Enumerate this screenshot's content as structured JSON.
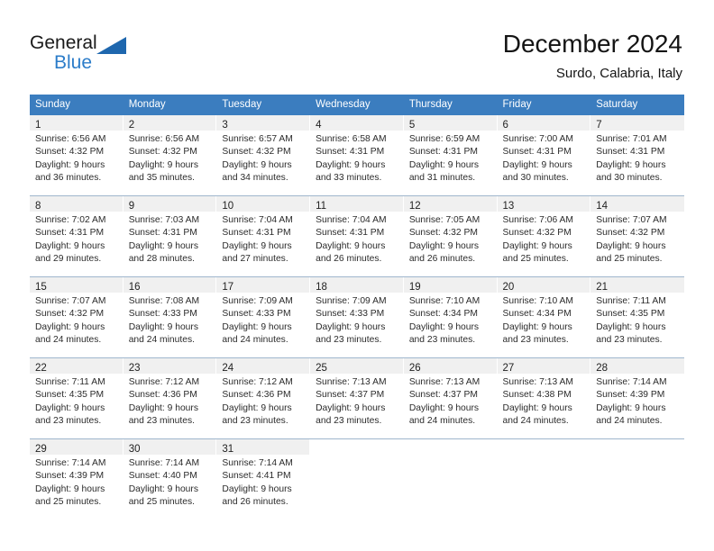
{
  "brand": {
    "name_dark": "General",
    "name_blue": "Blue",
    "accent_blue": "#2b7cc9",
    "triangle_blue": "#1e67ae"
  },
  "header": {
    "title": "December 2024",
    "subtitle": "Surdo, Calabria, Italy"
  },
  "calendar": {
    "header_bg": "#3b7dbf",
    "header_text_color": "#ffffff",
    "daynum_band_bg": "#f0f0f0",
    "row_divider_color": "#9fb6cd",
    "weekdays": [
      "Sunday",
      "Monday",
      "Tuesday",
      "Wednesday",
      "Thursday",
      "Friday",
      "Saturday"
    ],
    "weeks": [
      [
        {
          "day": "1",
          "sunrise": "Sunrise: 6:56 AM",
          "sunset": "Sunset: 4:32 PM",
          "daylight1": "Daylight: 9 hours",
          "daylight2": "and 36 minutes."
        },
        {
          "day": "2",
          "sunrise": "Sunrise: 6:56 AM",
          "sunset": "Sunset: 4:32 PM",
          "daylight1": "Daylight: 9 hours",
          "daylight2": "and 35 minutes."
        },
        {
          "day": "3",
          "sunrise": "Sunrise: 6:57 AM",
          "sunset": "Sunset: 4:32 PM",
          "daylight1": "Daylight: 9 hours",
          "daylight2": "and 34 minutes."
        },
        {
          "day": "4",
          "sunrise": "Sunrise: 6:58 AM",
          "sunset": "Sunset: 4:31 PM",
          "daylight1": "Daylight: 9 hours",
          "daylight2": "and 33 minutes."
        },
        {
          "day": "5",
          "sunrise": "Sunrise: 6:59 AM",
          "sunset": "Sunset: 4:31 PM",
          "daylight1": "Daylight: 9 hours",
          "daylight2": "and 31 minutes."
        },
        {
          "day": "6",
          "sunrise": "Sunrise: 7:00 AM",
          "sunset": "Sunset: 4:31 PM",
          "daylight1": "Daylight: 9 hours",
          "daylight2": "and 30 minutes."
        },
        {
          "day": "7",
          "sunrise": "Sunrise: 7:01 AM",
          "sunset": "Sunset: 4:31 PM",
          "daylight1": "Daylight: 9 hours",
          "daylight2": "and 30 minutes."
        }
      ],
      [
        {
          "day": "8",
          "sunrise": "Sunrise: 7:02 AM",
          "sunset": "Sunset: 4:31 PM",
          "daylight1": "Daylight: 9 hours",
          "daylight2": "and 29 minutes."
        },
        {
          "day": "9",
          "sunrise": "Sunrise: 7:03 AM",
          "sunset": "Sunset: 4:31 PM",
          "daylight1": "Daylight: 9 hours",
          "daylight2": "and 28 minutes."
        },
        {
          "day": "10",
          "sunrise": "Sunrise: 7:04 AM",
          "sunset": "Sunset: 4:31 PM",
          "daylight1": "Daylight: 9 hours",
          "daylight2": "and 27 minutes."
        },
        {
          "day": "11",
          "sunrise": "Sunrise: 7:04 AM",
          "sunset": "Sunset: 4:31 PM",
          "daylight1": "Daylight: 9 hours",
          "daylight2": "and 26 minutes."
        },
        {
          "day": "12",
          "sunrise": "Sunrise: 7:05 AM",
          "sunset": "Sunset: 4:32 PM",
          "daylight1": "Daylight: 9 hours",
          "daylight2": "and 26 minutes."
        },
        {
          "day": "13",
          "sunrise": "Sunrise: 7:06 AM",
          "sunset": "Sunset: 4:32 PM",
          "daylight1": "Daylight: 9 hours",
          "daylight2": "and 25 minutes."
        },
        {
          "day": "14",
          "sunrise": "Sunrise: 7:07 AM",
          "sunset": "Sunset: 4:32 PM",
          "daylight1": "Daylight: 9 hours",
          "daylight2": "and 25 minutes."
        }
      ],
      [
        {
          "day": "15",
          "sunrise": "Sunrise: 7:07 AM",
          "sunset": "Sunset: 4:32 PM",
          "daylight1": "Daylight: 9 hours",
          "daylight2": "and 24 minutes."
        },
        {
          "day": "16",
          "sunrise": "Sunrise: 7:08 AM",
          "sunset": "Sunset: 4:33 PM",
          "daylight1": "Daylight: 9 hours",
          "daylight2": "and 24 minutes."
        },
        {
          "day": "17",
          "sunrise": "Sunrise: 7:09 AM",
          "sunset": "Sunset: 4:33 PM",
          "daylight1": "Daylight: 9 hours",
          "daylight2": "and 24 minutes."
        },
        {
          "day": "18",
          "sunrise": "Sunrise: 7:09 AM",
          "sunset": "Sunset: 4:33 PM",
          "daylight1": "Daylight: 9 hours",
          "daylight2": "and 23 minutes."
        },
        {
          "day": "19",
          "sunrise": "Sunrise: 7:10 AM",
          "sunset": "Sunset: 4:34 PM",
          "daylight1": "Daylight: 9 hours",
          "daylight2": "and 23 minutes."
        },
        {
          "day": "20",
          "sunrise": "Sunrise: 7:10 AM",
          "sunset": "Sunset: 4:34 PM",
          "daylight1": "Daylight: 9 hours",
          "daylight2": "and 23 minutes."
        },
        {
          "day": "21",
          "sunrise": "Sunrise: 7:11 AM",
          "sunset": "Sunset: 4:35 PM",
          "daylight1": "Daylight: 9 hours",
          "daylight2": "and 23 minutes."
        }
      ],
      [
        {
          "day": "22",
          "sunrise": "Sunrise: 7:11 AM",
          "sunset": "Sunset: 4:35 PM",
          "daylight1": "Daylight: 9 hours",
          "daylight2": "and 23 minutes."
        },
        {
          "day": "23",
          "sunrise": "Sunrise: 7:12 AM",
          "sunset": "Sunset: 4:36 PM",
          "daylight1": "Daylight: 9 hours",
          "daylight2": "and 23 minutes."
        },
        {
          "day": "24",
          "sunrise": "Sunrise: 7:12 AM",
          "sunset": "Sunset: 4:36 PM",
          "daylight1": "Daylight: 9 hours",
          "daylight2": "and 23 minutes."
        },
        {
          "day": "25",
          "sunrise": "Sunrise: 7:13 AM",
          "sunset": "Sunset: 4:37 PM",
          "daylight1": "Daylight: 9 hours",
          "daylight2": "and 23 minutes."
        },
        {
          "day": "26",
          "sunrise": "Sunrise: 7:13 AM",
          "sunset": "Sunset: 4:37 PM",
          "daylight1": "Daylight: 9 hours",
          "daylight2": "and 24 minutes."
        },
        {
          "day": "27",
          "sunrise": "Sunrise: 7:13 AM",
          "sunset": "Sunset: 4:38 PM",
          "daylight1": "Daylight: 9 hours",
          "daylight2": "and 24 minutes."
        },
        {
          "day": "28",
          "sunrise": "Sunrise: 7:14 AM",
          "sunset": "Sunset: 4:39 PM",
          "daylight1": "Daylight: 9 hours",
          "daylight2": "and 24 minutes."
        }
      ],
      [
        {
          "day": "29",
          "sunrise": "Sunrise: 7:14 AM",
          "sunset": "Sunset: 4:39 PM",
          "daylight1": "Daylight: 9 hours",
          "daylight2": "and 25 minutes."
        },
        {
          "day": "30",
          "sunrise": "Sunrise: 7:14 AM",
          "sunset": "Sunset: 4:40 PM",
          "daylight1": "Daylight: 9 hours",
          "daylight2": "and 25 minutes."
        },
        {
          "day": "31",
          "sunrise": "Sunrise: 7:14 AM",
          "sunset": "Sunset: 4:41 PM",
          "daylight1": "Daylight: 9 hours",
          "daylight2": "and 26 minutes."
        },
        {
          "day": "",
          "sunrise": "",
          "sunset": "",
          "daylight1": "",
          "daylight2": ""
        },
        {
          "day": "",
          "sunrise": "",
          "sunset": "",
          "daylight1": "",
          "daylight2": ""
        },
        {
          "day": "",
          "sunrise": "",
          "sunset": "",
          "daylight1": "",
          "daylight2": ""
        },
        {
          "day": "",
          "sunrise": "",
          "sunset": "",
          "daylight1": "",
          "daylight2": ""
        }
      ]
    ]
  }
}
